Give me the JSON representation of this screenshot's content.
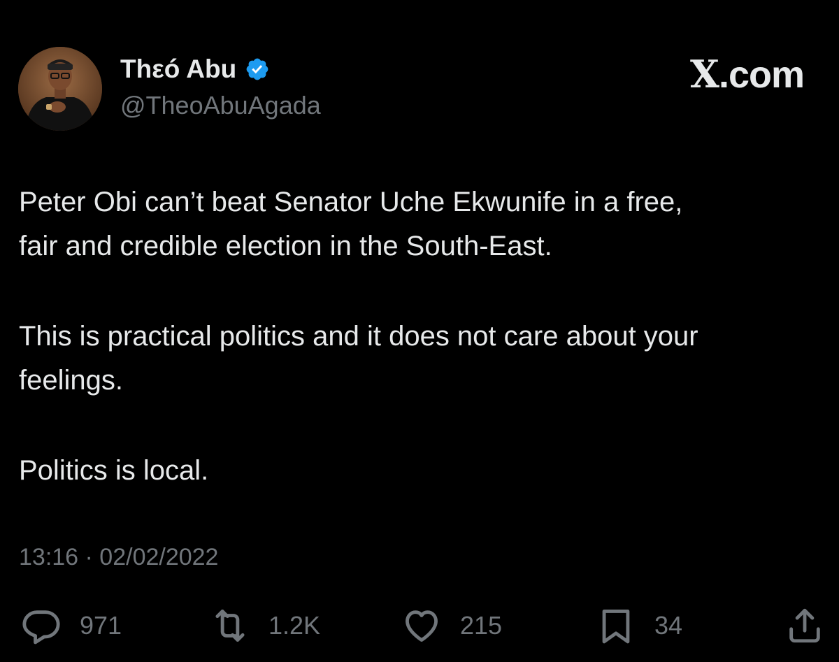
{
  "author": {
    "display_name": "Thεó Abu",
    "handle": "@TheoAbuAgada",
    "verified": true,
    "verified_color": "#1d9bf0"
  },
  "brand": {
    "x_letter": "X",
    "suffix": ".com"
  },
  "tweet": {
    "paragraphs": [
      "Peter Obi can’t beat Senator Uche Ekwunife in a free,\nfair and credible election in the South-East.",
      "This is practical politics and it does not care about your\nfeelings.",
      "Politics is local."
    ],
    "timestamp": "13:16 · 02/02/2022"
  },
  "actions": {
    "reply": {
      "icon": "reply-icon",
      "count": "971"
    },
    "retweet": {
      "icon": "retweet-icon",
      "count": "1.2K"
    },
    "like": {
      "icon": "heart-icon",
      "count": "215"
    },
    "bookmark": {
      "icon": "bookmark-icon",
      "count": "34"
    },
    "share": {
      "icon": "share-icon"
    }
  },
  "colors": {
    "background": "#000000",
    "primary_text": "#e7e9ea",
    "secondary_text": "#71767b"
  }
}
